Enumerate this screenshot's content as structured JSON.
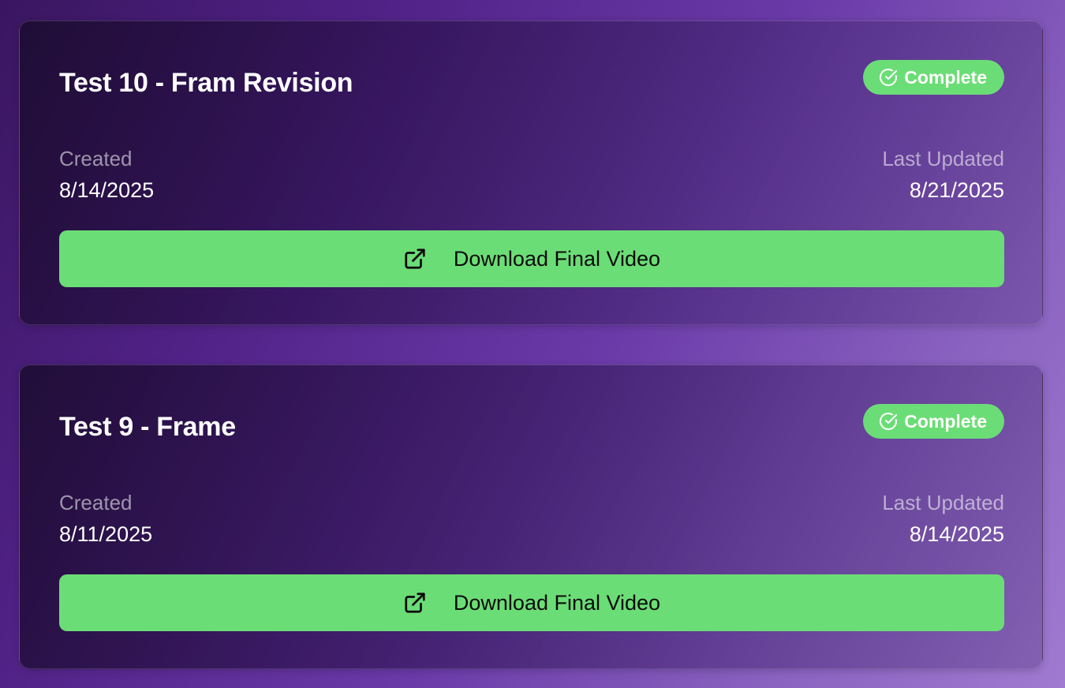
{
  "projects": [
    {
      "title": "Test 10 - Fram Revision",
      "status": "Complete",
      "created_label": "Created",
      "created_date": "8/14/2025",
      "updated_label": "Last Updated",
      "updated_date": "8/21/2025",
      "button_label": "Download Final Video"
    },
    {
      "title": "Test 9 - Frame",
      "status": "Complete",
      "created_label": "Created",
      "created_date": "8/11/2025",
      "updated_label": "Last Updated",
      "updated_date": "8/14/2025",
      "button_label": "Download Final Video"
    }
  ],
  "icons": {
    "status": "check-circle-icon",
    "download": "external-link-icon"
  },
  "colors": {
    "accent_green": "#6bdd76"
  }
}
